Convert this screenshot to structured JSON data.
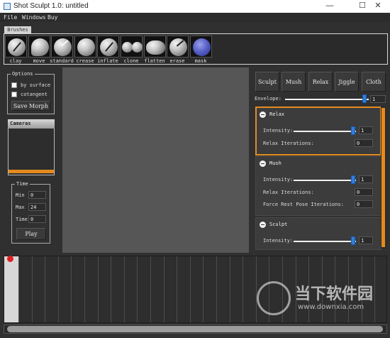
{
  "window": {
    "title": "Shot Sculpt 1.0: untitled",
    "minimize": "—",
    "maximize": "☐",
    "close": "✕"
  },
  "menu": [
    "File",
    "Windows",
    "Buy"
  ],
  "brushes": {
    "tab": "Brushes",
    "items": [
      "clay",
      "move",
      "standard",
      "crease",
      "inflate",
      "clone",
      "flatten",
      "erase",
      "mask"
    ]
  },
  "options": {
    "title": "Options",
    "by_surface": "by surface",
    "cotangent": "cotangent",
    "save_morph": "Save Morph"
  },
  "cameras": {
    "title": "Cameras"
  },
  "time": {
    "title": "Time",
    "min_label": "Min",
    "min_value": "0",
    "max_label": "Max",
    "max_value": "24",
    "time_label": "Time",
    "time_value": "0",
    "play": "Play"
  },
  "solvers": [
    "Sculpt",
    "Mush",
    "Relax",
    "Jiggle",
    "Cloth"
  ],
  "envelope": {
    "label": "Envelope:",
    "value": "1",
    "level": 0.95
  },
  "relax": {
    "title": "Relax",
    "intensity_label": "Intensity:",
    "intensity_value": "1",
    "intensity_level": 0.95,
    "iterations_label": "Relax Iterations:",
    "iterations_value": "0"
  },
  "mush": {
    "title": "Mush",
    "intensity_label": "Intensity:",
    "intensity_value": "1",
    "intensity_level": 0.95,
    "iterations_label": "Relax Iterations:",
    "iterations_value": "0",
    "force_label": "Force Rest Pose Iterations:",
    "force_value": "0"
  },
  "sculpt": {
    "title": "Sculpt",
    "intensity_label": "Intensity:",
    "intensity_value": "1",
    "intensity_level": 0.95
  },
  "watermark": {
    "brand": "当下软件园",
    "url": "www.downxia.com"
  },
  "colors": {
    "accent": "#e48a1c",
    "slider": "#2e7de0",
    "viewport": "#565656"
  }
}
